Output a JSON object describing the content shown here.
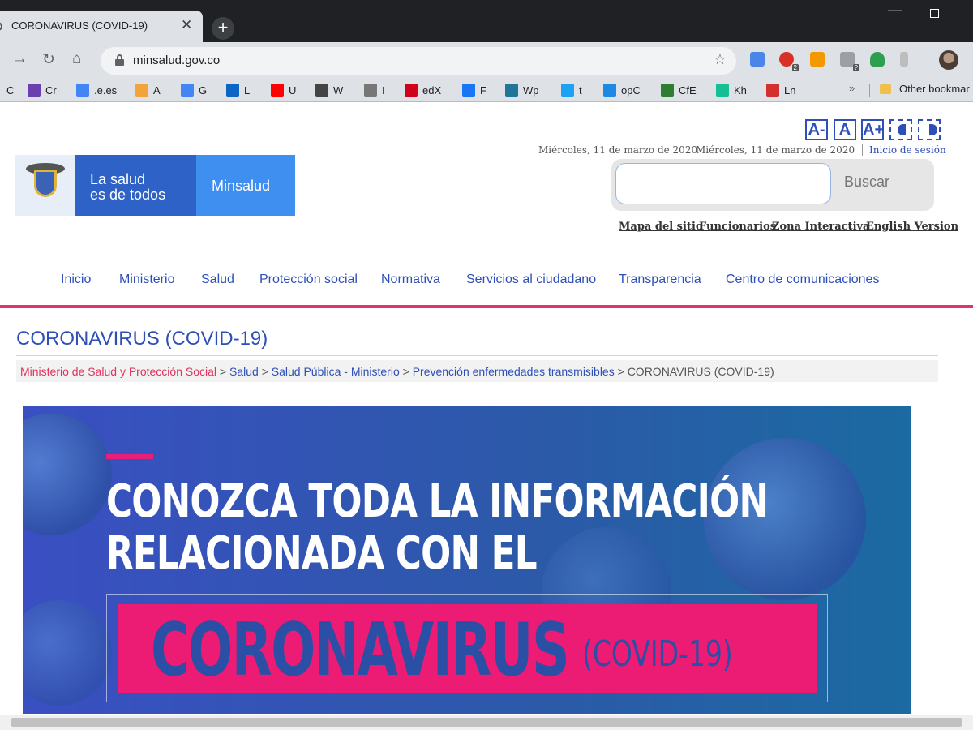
{
  "tab": {
    "title": "CORONAVIRUS (COVID-19)"
  },
  "omnibox": {
    "url": "minsalud.gov.co"
  },
  "bookmarks": [
    {
      "label": "C",
      "icon": "generic-icon",
      "color": "#1a73e8"
    },
    {
      "label": "Cr",
      "icon": "peace-icon",
      "color": "#6a3fb0"
    },
    {
      "label": ".e.es",
      "icon": "translate-icon",
      "color": "#4285f4"
    },
    {
      "label": "A",
      "icon": "amazon-icon",
      "color": "#f3a33b"
    },
    {
      "label": "G",
      "icon": "google-icon",
      "color": "#4285f4"
    },
    {
      "label": "L",
      "icon": "linkedin-icon",
      "color": "#0a66c2"
    },
    {
      "label": "U",
      "icon": "youtube-icon",
      "color": "#ff0000"
    },
    {
      "label": "W",
      "icon": "wikipedia-icon",
      "color": "#444444"
    },
    {
      "label": "I",
      "icon": "globe-icon",
      "color": "#777777"
    },
    {
      "label": "edX",
      "icon": "edx-icon",
      "color": "#d0021b"
    },
    {
      "label": "F",
      "icon": "facebook-icon",
      "color": "#1877f2"
    },
    {
      "label": "Wp",
      "icon": "wordpress-icon",
      "color": "#21759b"
    },
    {
      "label": "t",
      "icon": "twitter-icon",
      "color": "#1da1f2"
    },
    {
      "label": "opC",
      "icon": "opencourse-icon",
      "color": "#1e88e5"
    },
    {
      "label": "CfE",
      "icon": "cfe-icon",
      "color": "#2e7d32"
    },
    {
      "label": "Kh",
      "icon": "khan-icon",
      "color": "#14bf96"
    },
    {
      "label": "Ln",
      "icon": "apple-icon",
      "color": "#d32f2f"
    }
  ],
  "bookmarks_more": "»",
  "other_bookmarks": "Other bookmar",
  "header": {
    "accessibility": {
      "decrease": "A-",
      "normal": "A",
      "increase": "A+"
    },
    "date_1": "Miércoles, 11 de marzo de 2020",
    "date_2": "Miércoles, 11 de marzo de 2020",
    "login": "Inicio de sesión",
    "logo_line1": "La salud",
    "logo_line2": "es de todos",
    "logo_brand": "Minsalud",
    "search_button": "Buscar",
    "links": [
      "Mapa del sitio",
      "Funcionarios",
      "Zona Interactiva",
      "English Version"
    ]
  },
  "nav": [
    "Inicio",
    "Ministerio",
    "Salud",
    "Protección social",
    "Normativa",
    "Servicios al ciudadano",
    "Transparencia",
    "Centro de comunicaciones"
  ],
  "page": {
    "title": "CORONAVIRUS (COVID-19)",
    "breadcrumb": [
      "Ministerio de Salud y Protección Social",
      "Salud",
      "Salud Pública - Ministerio",
      "Prevención enfermedades transmisibles",
      "CORONAVIRUS (COVID-19)"
    ],
    "separator": ">"
  },
  "banner": {
    "line1": "CONOZCA TODA LA INFORMACIÓN",
    "line2": "RELACIONADA CON EL",
    "big": "CORONAVIRUS",
    "small": "(COVID-19)"
  },
  "colors": {
    "brand_blue": "#2f62c6",
    "brand_light": "#3f8ff1",
    "accent_pink": "#e6306f",
    "link": "#2e4fb8"
  }
}
